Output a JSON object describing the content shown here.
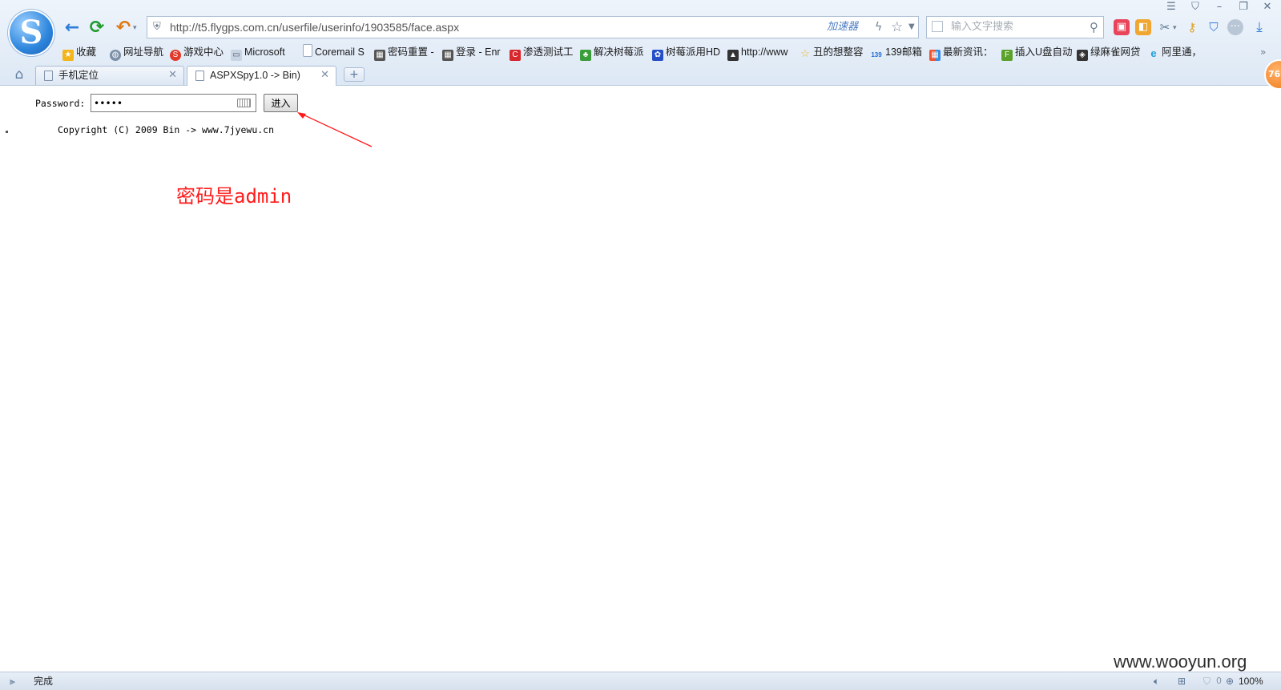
{
  "browser": {
    "address_url": "http://t5.flygps.com.cn/userfile/userinfo/1903585/face.aspx",
    "accelerator_label": "加速器",
    "search_placeholder": "输入文字搜索",
    "badge_count": "76",
    "colors": {
      "chrome": "#dde8f5",
      "refresh_green": "#1e9b2a",
      "back_blue": "#2f7bd9",
      "undo_orange": "#e07a12"
    }
  },
  "bookmarks": [
    {
      "label": "收藏",
      "icon": "star-icon",
      "color": "#f3b51c"
    },
    {
      "label": "网址导航",
      "icon": "globe-icon",
      "color": "#7c8fa6"
    },
    {
      "label": "游戏中心",
      "icon": "game-icon",
      "color": "#e23a2a"
    },
    {
      "label": "Microsoft",
      "icon": "folder-icon",
      "color": "#8aa0bb"
    },
    {
      "label": "Coremail S",
      "icon": "page-icon",
      "color": "#9aaac0"
    },
    {
      "label": "密码重置 -",
      "icon": "image-icon",
      "color": "#555555"
    },
    {
      "label": "登录 - Enr",
      "icon": "image-icon",
      "color": "#555555"
    },
    {
      "label": "渗透测试工",
      "icon": "c-logo-icon",
      "color": "#d8272d"
    },
    {
      "label": "解决树莓派",
      "icon": "plant-icon",
      "color": "#3c9e3a"
    },
    {
      "label": "树莓派用HD",
      "icon": "paw-icon",
      "color": "#2550c8"
    },
    {
      "label": "http://www",
      "icon": "image-icon",
      "color": "#333333"
    },
    {
      "label": "丑的想整容",
      "icon": "star-icon",
      "color": "#f3b51c"
    },
    {
      "label": "139邮箱",
      "icon": "139-icon",
      "color": "#1e6fd0"
    },
    {
      "label": "最新资讯：",
      "icon": "grid-icon",
      "color": "#3a8ee0"
    },
    {
      "label": "插入U盘自动",
      "icon": "f-logo-icon",
      "color": "#5aa22a"
    },
    {
      "label": "绿麻雀网贷",
      "icon": "image-icon",
      "color": "#333333"
    },
    {
      "label": "阿里通，",
      "icon": "e-logo-icon",
      "color": "#1e9fd8"
    }
  ],
  "tabs": [
    {
      "label": "手机定位",
      "active": false
    },
    {
      "label": "ASPXSpy1.0 -> Bin)",
      "active": true
    }
  ],
  "page": {
    "password_label": "Password:",
    "password_value": "admin",
    "enter_button": "进入",
    "copyright": "Copyright (C) 2009 Bin -> www.7jyewu.cn",
    "annotation": "密码是admin",
    "annotation_color": "#ff1a1a"
  },
  "watermark": "www.wooyun.org",
  "status": {
    "text": "完成",
    "blocked_count": "0",
    "zoom": "100%"
  }
}
